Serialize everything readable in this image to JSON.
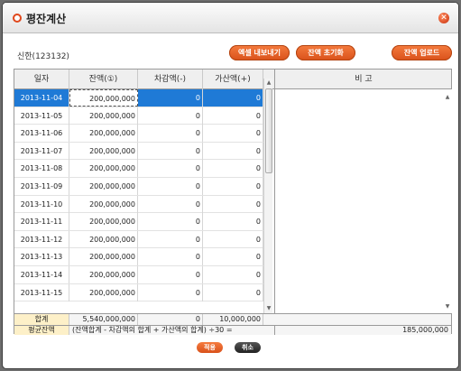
{
  "title": "평잔계산",
  "close_glyph": "✕",
  "account_label": "신한(123132)",
  "buttons": {
    "export": "엑셀 내보내기",
    "reset": "잔액 초기화",
    "upload": "잔액 업로드",
    "apply": "적용",
    "cancel": "취소"
  },
  "columns": {
    "date": "일자",
    "balance": "잔액(①)",
    "decrease": "차감액(-)",
    "increase": "가산액(+)",
    "memo": "비 고"
  },
  "rows": [
    {
      "date": "2013-11-04",
      "balance": "200,000,000",
      "decrease": "0",
      "increase": "0"
    },
    {
      "date": "2013-11-05",
      "balance": "200,000,000",
      "decrease": "0",
      "increase": "0"
    },
    {
      "date": "2013-11-06",
      "balance": "200,000,000",
      "decrease": "0",
      "increase": "0"
    },
    {
      "date": "2013-11-07",
      "balance": "200,000,000",
      "decrease": "0",
      "increase": "0"
    },
    {
      "date": "2013-11-08",
      "balance": "200,000,000",
      "decrease": "0",
      "increase": "0"
    },
    {
      "date": "2013-11-09",
      "balance": "200,000,000",
      "decrease": "0",
      "increase": "0"
    },
    {
      "date": "2013-11-10",
      "balance": "200,000,000",
      "decrease": "0",
      "increase": "0"
    },
    {
      "date": "2013-11-11",
      "balance": "200,000,000",
      "decrease": "0",
      "increase": "0"
    },
    {
      "date": "2013-11-12",
      "balance": "200,000,000",
      "decrease": "0",
      "increase": "0"
    },
    {
      "date": "2013-11-13",
      "balance": "200,000,000",
      "decrease": "0",
      "increase": "0"
    },
    {
      "date": "2013-11-14",
      "balance": "200,000,000",
      "decrease": "0",
      "increase": "0"
    },
    {
      "date": "2013-11-15",
      "balance": "200,000,000",
      "decrease": "0",
      "increase": "0"
    }
  ],
  "total": {
    "label": "합계",
    "balance": "5,540,000,000",
    "decrease": "0",
    "increase": "10,000,000"
  },
  "average": {
    "label": "평균잔액",
    "formula": "(잔액합계 - 차감액의 합계 + 가산액의 합계) ÷30 =",
    "value": "185,000,000"
  },
  "colors": {
    "accent": "#e0571f",
    "selection": "#1f7ad6",
    "sum_label_bg": "#fdf0c8"
  },
  "icons": {
    "title": "circle-icon",
    "close": "close-icon",
    "scroll_up": "scroll-up-icon",
    "scroll_down": "scroll-down-icon"
  }
}
